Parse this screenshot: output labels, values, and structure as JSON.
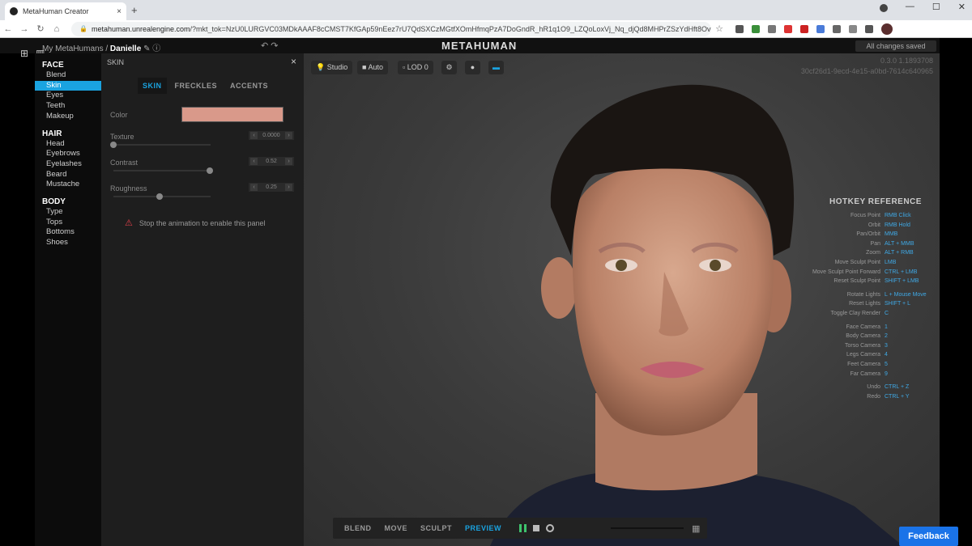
{
  "browser": {
    "tab_title": "MetaHuman Creator",
    "tab_close": "×",
    "new_tab": "+",
    "url_host": "metahuman.unrealengine.com",
    "url_rest": "/?mkt_tok=NzU0LURGVC03MDkAAAF8cCMST7KfGAp59nEez7rU7QdSXCzMGtfXOmHfmqPzA7DoGndR_hR1q1O9_LZQoLoxVj_Nq_djQd8MHPrZSzYdHft8Ovm2A3JloV..."
  },
  "app": {
    "breadcrumb_parent": "My MetaHumans",
    "breadcrumb_sep": "/",
    "character_name": "Danielle",
    "brand": "METAHUMAN",
    "saved_status": "All changes saved",
    "version_line1": "0.3.0 1.1893708",
    "version_line2": "30cf26d1-9ecd-4e15-a0bd-7614c640965"
  },
  "nav": {
    "face": {
      "title": "FACE",
      "items": [
        "Blend",
        "Skin",
        "Eyes",
        "Teeth",
        "Makeup"
      ]
    },
    "hair": {
      "title": "HAIR",
      "items": [
        "Head",
        "Eyebrows",
        "Eyelashes",
        "Beard",
        "Mustache"
      ]
    },
    "body": {
      "title": "BODY",
      "items": [
        "Type",
        "Tops",
        "Bottoms",
        "Shoes"
      ]
    }
  },
  "panel": {
    "title": "SKIN",
    "close": "×",
    "tabs": [
      "SKIN",
      "FRECKLES",
      "ACCENTS"
    ],
    "color_label": "Color",
    "color_value": "#d9998a",
    "texture_label": "Texture",
    "texture_value": "0.0000",
    "texture_level": 0.0,
    "contrast_label": "Contrast",
    "contrast_value": "0.52",
    "contrast_level": 0.52,
    "roughness_label": "Roughness",
    "roughness_value": "0.25",
    "roughness_level": 0.25,
    "warning": "Stop the animation to enable this panel"
  },
  "viewport_toolbar": {
    "studio": "Studio",
    "auto": "Auto",
    "lod": "LOD 0"
  },
  "hotkeys": {
    "title": "HOTKEY REFERENCE",
    "groups": [
      [
        [
          "Focus Point",
          "RMB Click"
        ],
        [
          "Orbit",
          "RMB Hold"
        ],
        [
          "Pan/Orbit",
          "MMB"
        ],
        [
          "Pan",
          "ALT + MMB"
        ],
        [
          "Zoom",
          "ALT + RMB"
        ],
        [
          "Move Sculpt Point",
          "LMB"
        ],
        [
          "Move Sculpt Point Forward",
          "CTRL + LMB"
        ],
        [
          "Reset Sculpt Point",
          "SHIFT + LMB"
        ]
      ],
      [
        [
          "Rotate Lights",
          "L + Mouse Move"
        ],
        [
          "Reset Lights",
          "SHIFT + L"
        ],
        [
          "Toggle Clay Render",
          "C"
        ]
      ],
      [
        [
          "Face Camera",
          "1"
        ],
        [
          "Body Camera",
          "2"
        ],
        [
          "Torso Camera",
          "3"
        ],
        [
          "Legs Camera",
          "4"
        ],
        [
          "Feet Camera",
          "5"
        ],
        [
          "Far Camera",
          "9"
        ]
      ],
      [
        [
          "Undo",
          "CTRL + Z"
        ],
        [
          "Redo",
          "CTRL + Y"
        ]
      ]
    ]
  },
  "modes": [
    "BLEND",
    "MOVE",
    "SCULPT",
    "PREVIEW"
  ],
  "active_mode": "PREVIEW",
  "feedback": "Feedback",
  "colors": {
    "accent": "#1aa3e0",
    "warning": "#e0404a",
    "hotkey": "#3fa9e6"
  }
}
